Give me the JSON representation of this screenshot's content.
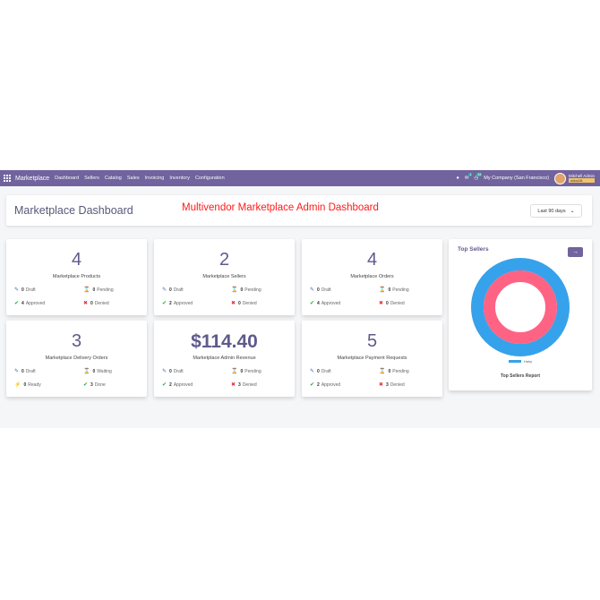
{
  "navbar": {
    "brand": "Marketplace",
    "menu": [
      "Dashboard",
      "Sellers",
      "Catalog",
      "Sales",
      "Invoicing",
      "Inventory",
      "Configuration"
    ],
    "company": "My Company (San Francisco)",
    "messages_count": "1",
    "activity_count": "33",
    "user_name": "Mitchell Admin",
    "user_db": "odoo16"
  },
  "header": {
    "title": "Marketplace Dashboard",
    "banner": "Multivendor Marketplace Admin Dashboard",
    "range": "Last 90 days"
  },
  "cards": [
    {
      "value": "4",
      "label": "Marketplace Products",
      "s1": {
        "icon": "edit-icon",
        "count": "0",
        "text": "Draft"
      },
      "s2": {
        "icon": "hourglass-icon",
        "count": "0",
        "text": "Pending"
      },
      "s3": {
        "icon": "check-circle-icon",
        "count": "4",
        "text": "Approved"
      },
      "s4": {
        "icon": "times-circle-icon",
        "count": "0",
        "text": "Denied"
      }
    },
    {
      "value": "2",
      "label": "Marketplace Sellers",
      "s1": {
        "icon": "edit-icon",
        "count": "0",
        "text": "Draft"
      },
      "s2": {
        "icon": "hourglass-icon",
        "count": "0",
        "text": "Pending"
      },
      "s3": {
        "icon": "check-circle-icon",
        "count": "2",
        "text": "Approved"
      },
      "s4": {
        "icon": "times-circle-icon",
        "count": "0",
        "text": "Denied"
      }
    },
    {
      "value": "4",
      "label": "Marketplace Orders",
      "s1": {
        "icon": "edit-icon",
        "count": "0",
        "text": "Draft"
      },
      "s2": {
        "icon": "hourglass-icon",
        "count": "0",
        "text": "Pending"
      },
      "s3": {
        "icon": "check-circle-icon",
        "count": "4",
        "text": "Approved"
      },
      "s4": {
        "icon": "times-circle-icon",
        "count": "0",
        "text": "Denied"
      }
    },
    {
      "value": "3",
      "label": "Marketplace Delivery Orders",
      "s1": {
        "icon": "edit-icon",
        "count": "0",
        "text": "Draft"
      },
      "s2": {
        "icon": "hourglass-icon",
        "count": "0",
        "text": "Waiting"
      },
      "s3": {
        "icon": "bolt-icon",
        "count": "0",
        "text": "Ready"
      },
      "s4": {
        "icon": "check-circle-icon",
        "count": "3",
        "text": "Done"
      }
    },
    {
      "value": "$114.40",
      "label": "Marketplace Admin Revenue",
      "s1": {
        "icon": "edit-icon",
        "count": "0",
        "text": "Draft"
      },
      "s2": {
        "icon": "hourglass-icon",
        "count": "0",
        "text": "Pending"
      },
      "s3": {
        "icon": "check-circle-icon",
        "count": "2",
        "text": "Approved"
      },
      "s4": {
        "icon": "times-circle-icon",
        "count": "3",
        "text": "Denied"
      }
    },
    {
      "value": "5",
      "label": "Marketplace Payment Requests",
      "s1": {
        "icon": "edit-icon",
        "count": "0",
        "text": "Draft"
      },
      "s2": {
        "icon": "hourglass-icon",
        "count": "0",
        "text": "Pending"
      },
      "s3": {
        "icon": "check-circle-icon",
        "count": "2",
        "text": "Approved"
      },
      "s4": {
        "icon": "times-circle-icon",
        "count": "3",
        "text": "Denied"
      }
    }
  ],
  "top_sellers": {
    "title": "Top Sellers",
    "legend": "Hairy",
    "caption": "Top Sellers Report",
    "colors": {
      "outer": "#36a2eb",
      "inner": "#ff6384"
    }
  },
  "colors": {
    "brand": "#71639e",
    "accent_text": "#5e5a8d",
    "banner": "#ff1a1a"
  }
}
